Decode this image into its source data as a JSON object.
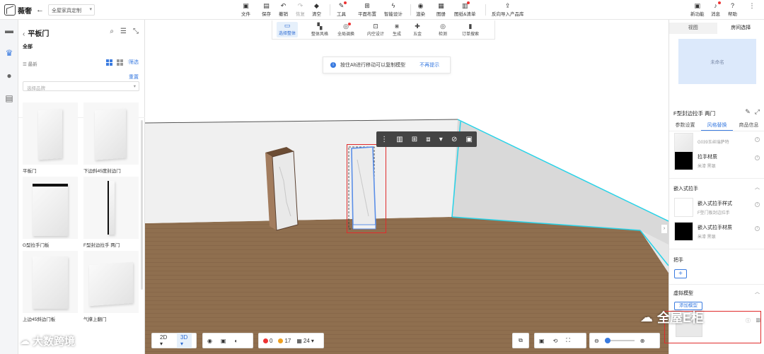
{
  "topbar": {
    "logo_text": "薇奢",
    "scheme_label": "全屋家具定制",
    "tools": [
      {
        "label": "文件",
        "icon": "file-icon"
      },
      {
        "label": "保存",
        "icon": "save-icon"
      },
      {
        "label": "撤销",
        "icon": "undo-icon"
      },
      {
        "label": "恢复",
        "icon": "redo-icon"
      },
      {
        "label": "清空",
        "icon": "eraser-icon"
      },
      {
        "label": "工具",
        "icon": "wrench-icon"
      },
      {
        "label": "平面布置",
        "icon": "floor-plan-icon"
      },
      {
        "label": "智能设计",
        "icon": "lightning-icon"
      },
      {
        "label": "渲染",
        "icon": "camera-icon"
      },
      {
        "label": "图册",
        "icon": "album-icon"
      },
      {
        "label": "图纸&清单",
        "icon": "drawing-icon"
      },
      {
        "label": "反向导入产品库",
        "icon": "import-icon"
      }
    ],
    "right_tools": [
      {
        "label": "新功能",
        "icon": "new-feature-icon"
      },
      {
        "label": "消息",
        "icon": "bell-icon"
      },
      {
        "label": "帮助",
        "icon": "help-icon"
      }
    ]
  },
  "subbar": {
    "tools": [
      {
        "label": "选择整体"
      },
      {
        "label": "整体风格"
      },
      {
        "label": "全局调换"
      },
      {
        "label": "内空设计"
      },
      {
        "label": "生成"
      },
      {
        "label": "五金"
      },
      {
        "label": "检测"
      },
      {
        "label": "订单搜索"
      }
    ]
  },
  "catalog": {
    "title": "平板门",
    "category": "全部",
    "sort_label": "最新",
    "filter_label": "筛选",
    "reset_label": "重置",
    "brand_placeholder": "选择品牌",
    "items": [
      {
        "name": "平板门"
      },
      {
        "name": "下边斜45度封边门"
      },
      {
        "name": "G型拉手门板"
      },
      {
        "name": "F型封边拉手 两门"
      },
      {
        "name": "上边45斜边门板"
      },
      {
        "name": "气撑上翻门"
      }
    ]
  },
  "viewport": {
    "hint_text": "按住Alt进行移动可以复制模型",
    "hint_link": "不再提示",
    "view_2d": "2D",
    "view_3d": "3D",
    "stats": {
      "errors": "0",
      "warnings": "17",
      "count": "24"
    }
  },
  "right_panel": {
    "tabs": [
      {
        "label": "视图"
      },
      {
        "label": "房间选择"
      }
    ],
    "room_name": "未命名",
    "object_title": "F型封边拉手 两门",
    "subtabs": [
      {
        "label": "参数设置"
      },
      {
        "label": "风格替换"
      },
      {
        "label": "商品信息"
      }
    ],
    "materials": [
      {
        "title": "G039玉丝瑞萨特",
        "sub": ""
      },
      {
        "title": "拉手材质",
        "sub": "米漆 黑银"
      }
    ],
    "section_embedded": "嵌入式拉手",
    "embedded_items": [
      {
        "title": "嵌入式拉手样式",
        "sub": "F型门板封边拉手"
      },
      {
        "title": "嵌入式拉手材质",
        "sub": "米漆 黑银"
      }
    ],
    "section_handle": "把手",
    "section_virtual": "虚拟模型",
    "add_model_label": "添加模型"
  },
  "watermarks": {
    "left": "大数跨境",
    "right": "全屋E柜"
  },
  "colors": {
    "accent": "#3a7be0",
    "annotation": "#e02b2b",
    "wall_edge": "#27d3e8",
    "floor": "#8a6a4a"
  }
}
